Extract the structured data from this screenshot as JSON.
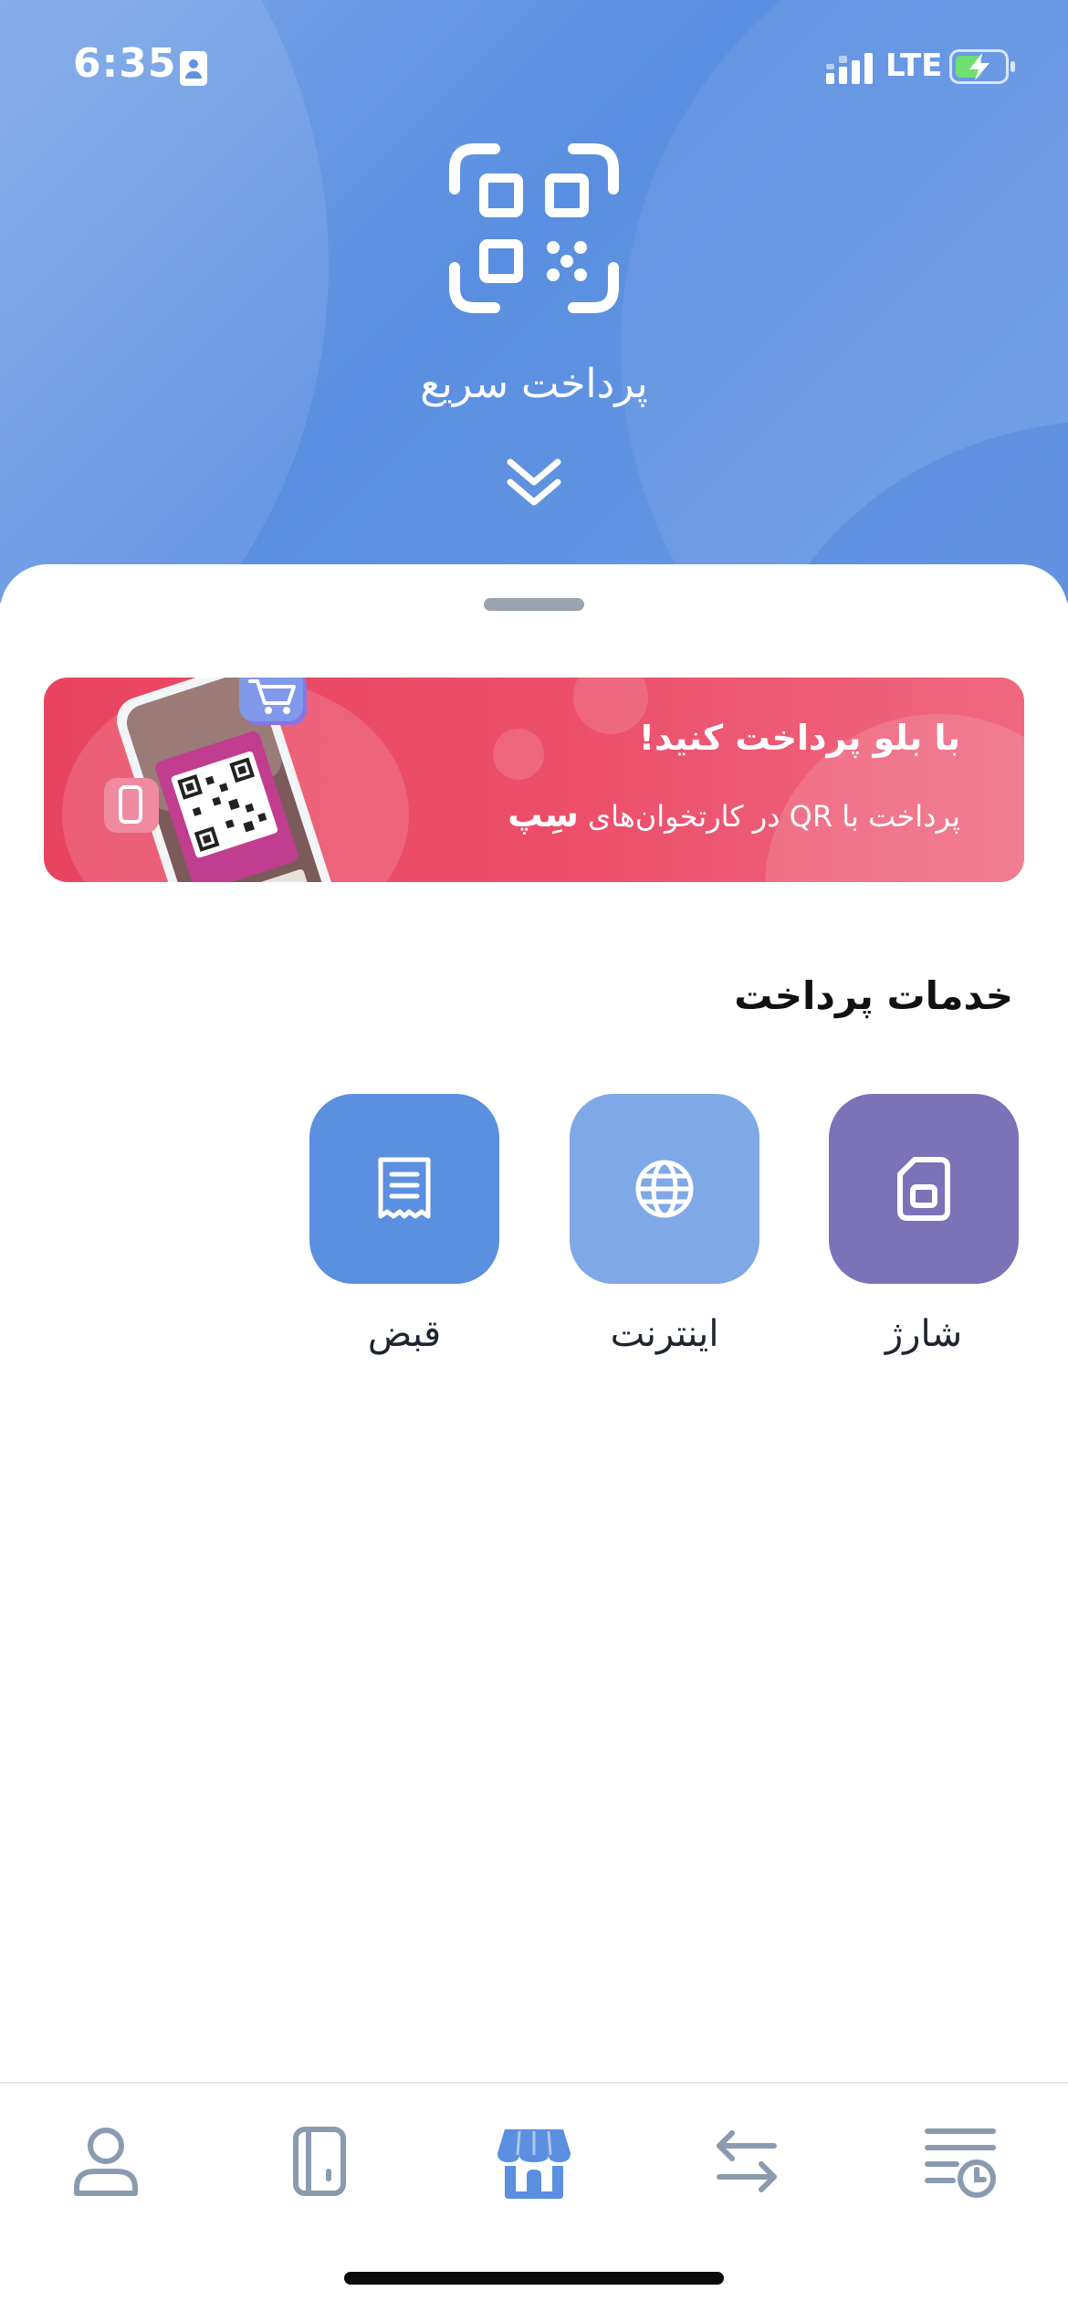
{
  "status_bar": {
    "time": "6:35",
    "network": "LTE"
  },
  "header": {
    "quick_pay_label": "پرداخت سریع",
    "icons": [
      "qr-code-icon",
      "double-chevron-down-icon"
    ]
  },
  "banner": {
    "title": "با بلو پرداخت کنید!",
    "subtitle_prefix": "پرداخت با QR در کارتخوان‌های",
    "brand": "سِپ",
    "colors": {
      "background": "#ec4a65"
    }
  },
  "services": {
    "title": "خدمات پرداخت",
    "items": [
      {
        "label": "شارژ",
        "icon": "sim-card-icon",
        "color": "#7b72b8"
      },
      {
        "label": "اینترنت",
        "icon": "globe-icon",
        "color": "#7fa8e6"
      },
      {
        "label": "قبض",
        "icon": "receipt-icon",
        "color": "#5b8fe0"
      }
    ]
  },
  "bottom_nav": {
    "items": [
      {
        "icon": "history-icon",
        "active": false
      },
      {
        "icon": "transfer-icon",
        "active": false
      },
      {
        "icon": "store-icon",
        "active": true
      },
      {
        "icon": "card-icon",
        "active": false
      },
      {
        "icon": "profile-icon",
        "active": false
      }
    ],
    "colors": {
      "active": "#5b8fe0",
      "inactive": "#8a9bb0"
    }
  }
}
